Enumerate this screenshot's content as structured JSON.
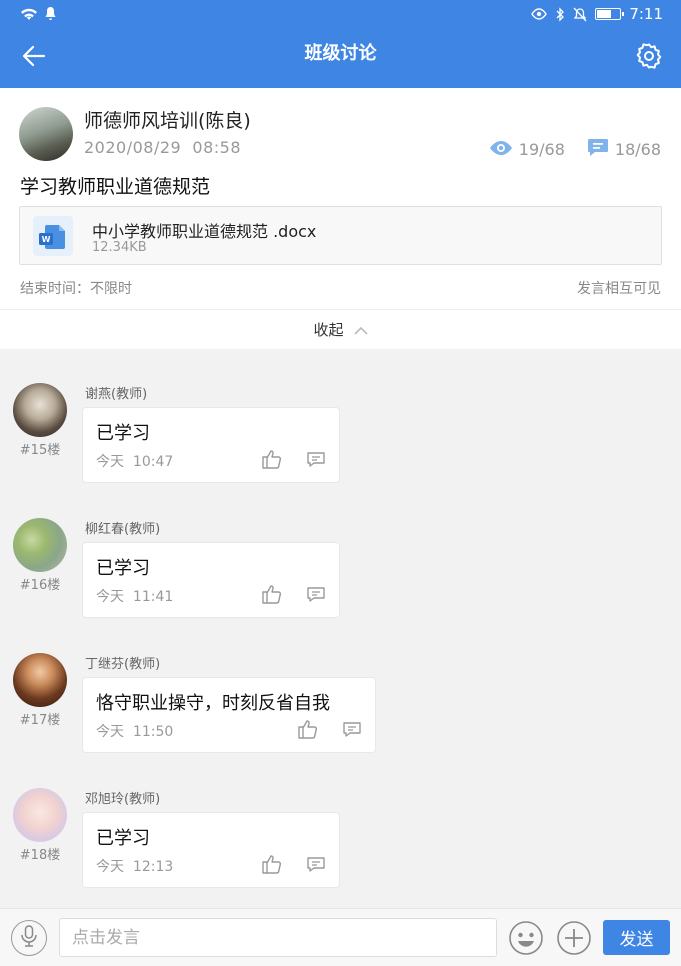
{
  "status_bar": {
    "time": "7:11"
  },
  "header": {
    "title": "班级讨论",
    "back_icon": "arrow-left-icon",
    "settings_icon": "gear-icon"
  },
  "topic": {
    "author": "师德师风培训(陈良)",
    "date": "2020/08/29",
    "time": "08:58",
    "views": "19/68",
    "replies": "18/68",
    "title": "学习教师职业道德规范",
    "attachment": {
      "name": "中小学教师职业道德规范  .docx",
      "size": "12.34KB"
    },
    "end_time_label": "结束时间：",
    "end_time_value": "不限时",
    "visibility": "发言相互可见"
  },
  "collapse_label": "收起",
  "replies": [
    {
      "name": "谢燕(教师)",
      "floor": "#15楼",
      "text": "已学习",
      "day": "今天",
      "time": "10:47"
    },
    {
      "name": "柳红春(教师)",
      "floor": "#16楼",
      "text": "已学习",
      "day": "今天",
      "time": "11:41"
    },
    {
      "name": "丁继芬(教师)",
      "floor": "#17楼",
      "text": "恪守职业操守，时刻反省自我",
      "day": "今天",
      "time": "11:50"
    },
    {
      "name": "邓旭玲(教师)",
      "floor": "#18楼",
      "text": "已学习",
      "day": "今天",
      "time": "12:13"
    }
  ],
  "input_bar": {
    "placeholder": "点击发言",
    "send_label": "发送"
  },
  "colors": {
    "primary": "#3e85e4",
    "background": "#f2f2f2"
  }
}
